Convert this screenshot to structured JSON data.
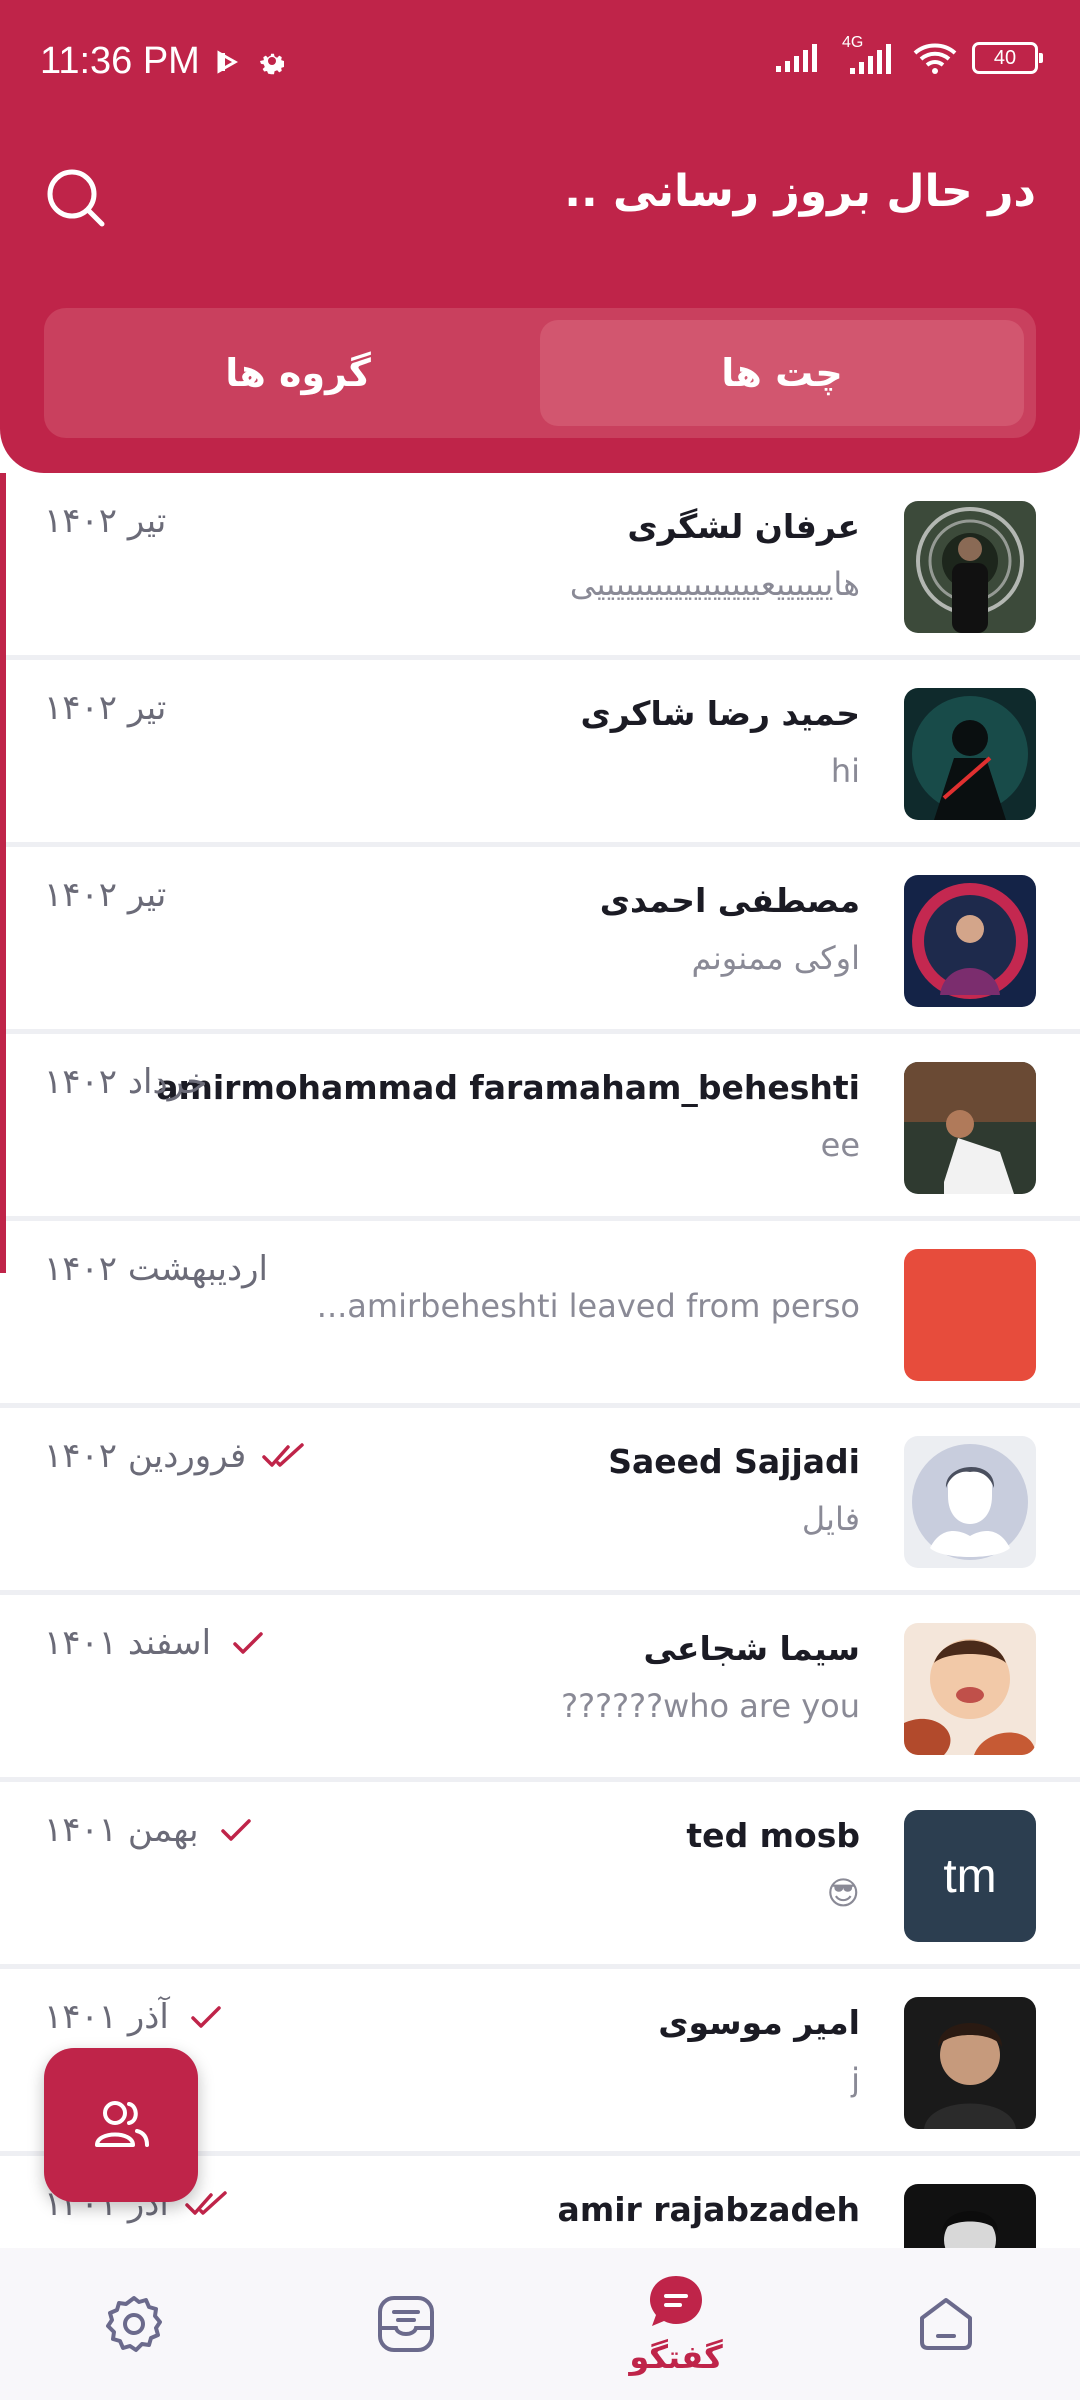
{
  "statusbar": {
    "time": "11:36 PM",
    "network": "4G",
    "battery": "40"
  },
  "header": {
    "title": "در حال بروز رسانی ..",
    "tabs": [
      {
        "label": "چت ها"
      },
      {
        "label": "گروه ها"
      }
    ]
  },
  "chats": [
    {
      "name": "عرفان لشگری",
      "message": "هاییییییعیییییییییییییییییی",
      "date": "تیر ۱۴۰۲",
      "ticks": "none"
    },
    {
      "name": "حمید رضا شاکری",
      "message": "hi",
      "date": "تیر ۱۴۰۲",
      "ticks": "none"
    },
    {
      "name": "مصطفی احمدی",
      "message": "اوکی ممنونم",
      "date": "تیر ۱۴۰۲",
      "ticks": "none"
    },
    {
      "name": "amirmohammad faramaham_beheshti",
      "message": "ee",
      "date": "خرداد ۱۴۰۲",
      "ticks": "none"
    },
    {
      "name": "",
      "message": "...amirbeheshti leaved from perso",
      "date": "اردیبهشت ۱۴۰۲",
      "ticks": "none"
    },
    {
      "name": "Saeed Sajjadi",
      "message": "فایل",
      "date": "فروردین ۱۴۰۲",
      "ticks": "double"
    },
    {
      "name": "سیما شجاعی",
      "message": "??????who are you",
      "date": "اسفند ۱۴۰۱",
      "ticks": "single"
    },
    {
      "name": "ted mosb",
      "message": "😎",
      "date": "بهمن ۱۴۰۱",
      "ticks": "single",
      "initials": "tm"
    },
    {
      "name": "امیر موسوی",
      "message": "j",
      "date": "آذر ۱۴۰۱",
      "ticks": "single"
    },
    {
      "name": "amir rajabzadeh",
      "message": "",
      "date": "آذر ۱۴۰۱",
      "ticks": "double"
    }
  ],
  "nav": {
    "active_label": "گفتگو"
  },
  "colors": {
    "primary": "#bf2449",
    "tab_bg": "#c9405e",
    "tab_active": "#d2566f"
  }
}
